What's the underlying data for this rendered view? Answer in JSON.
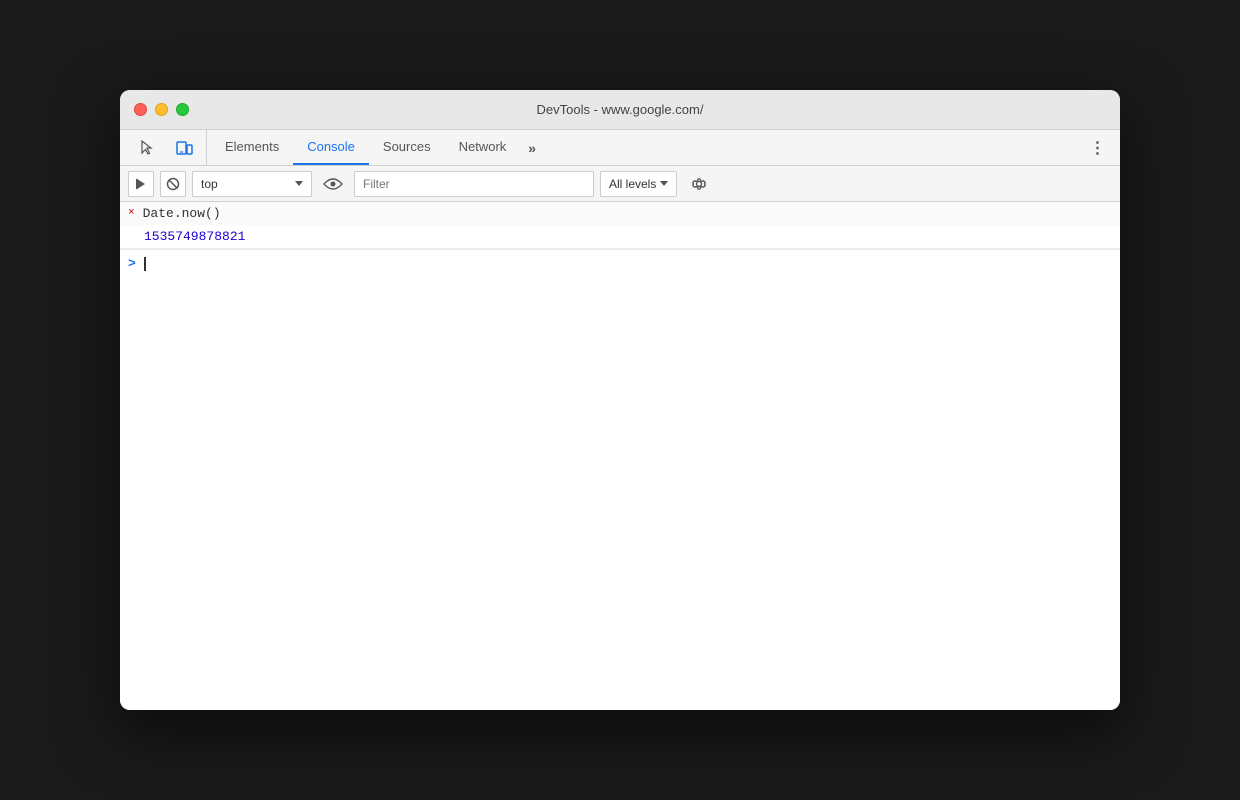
{
  "window": {
    "title": "DevTools - www.google.com/"
  },
  "traffic_lights": {
    "red_label": "close",
    "yellow_label": "minimize",
    "green_label": "maximize"
  },
  "tabs": {
    "items": [
      {
        "id": "elements",
        "label": "Elements",
        "active": false
      },
      {
        "id": "console",
        "label": "Console",
        "active": true
      },
      {
        "id": "sources",
        "label": "Sources",
        "active": false
      },
      {
        "id": "network",
        "label": "Network",
        "active": false
      }
    ],
    "more_label": "»",
    "menu_label": "⋮"
  },
  "console_toolbar": {
    "clear_label": "⊘",
    "context_value": "top",
    "context_placeholder": "top",
    "filter_placeholder": "Filter",
    "levels_label": "All levels",
    "settings_label": "⚙"
  },
  "console_entries": [
    {
      "type": "input",
      "marker": "×",
      "text": "Date.now()"
    },
    {
      "type": "output",
      "value": "1535749878821"
    }
  ],
  "console_prompt": {
    "arrow": ">"
  }
}
